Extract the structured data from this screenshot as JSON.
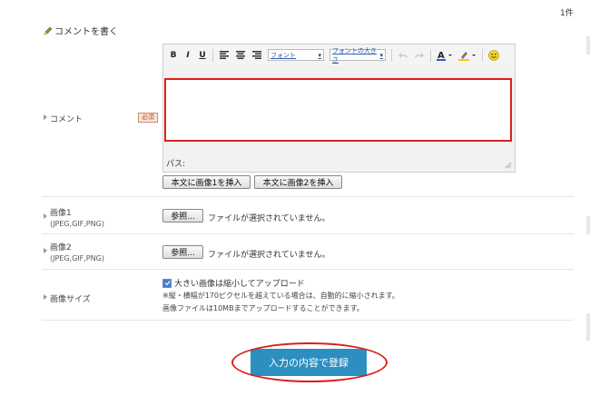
{
  "count": "1件",
  "heading": "コメントを書く",
  "comment_row": {
    "label": "コメント",
    "required": "必須",
    "toolbar": {
      "bold": "B",
      "italic": "I",
      "underline": "U",
      "font_select": "フォント",
      "size_select": "フォントの大きさ"
    },
    "path_label": "パス:",
    "insert_image1": "本文に画像1を挿入",
    "insert_image2": "本文に画像2を挿入"
  },
  "image1": {
    "label": "画像1",
    "sub": "(JPEG,GIF,PNG)",
    "browse": "参照...",
    "status": "ファイルが選択されていません。"
  },
  "image2": {
    "label": "画像2",
    "sub": "(JPEG,GIF,PNG)",
    "browse": "参照...",
    "status": "ファイルが選択されていません。"
  },
  "image_size": {
    "label": "画像サイズ",
    "checkbox_label": "大きい画像は縮小してアップロード",
    "checked": true,
    "note1": "※縦・横幅が170ピクセルを越えている場合は、自動的に縮小されます。",
    "note2": "画像ファイルは10MBまでアップロードすることができます。"
  },
  "submit": "入力の内容で登録",
  "colors": {
    "accent": "#2d8fbf",
    "highlight": "#d9201d"
  }
}
